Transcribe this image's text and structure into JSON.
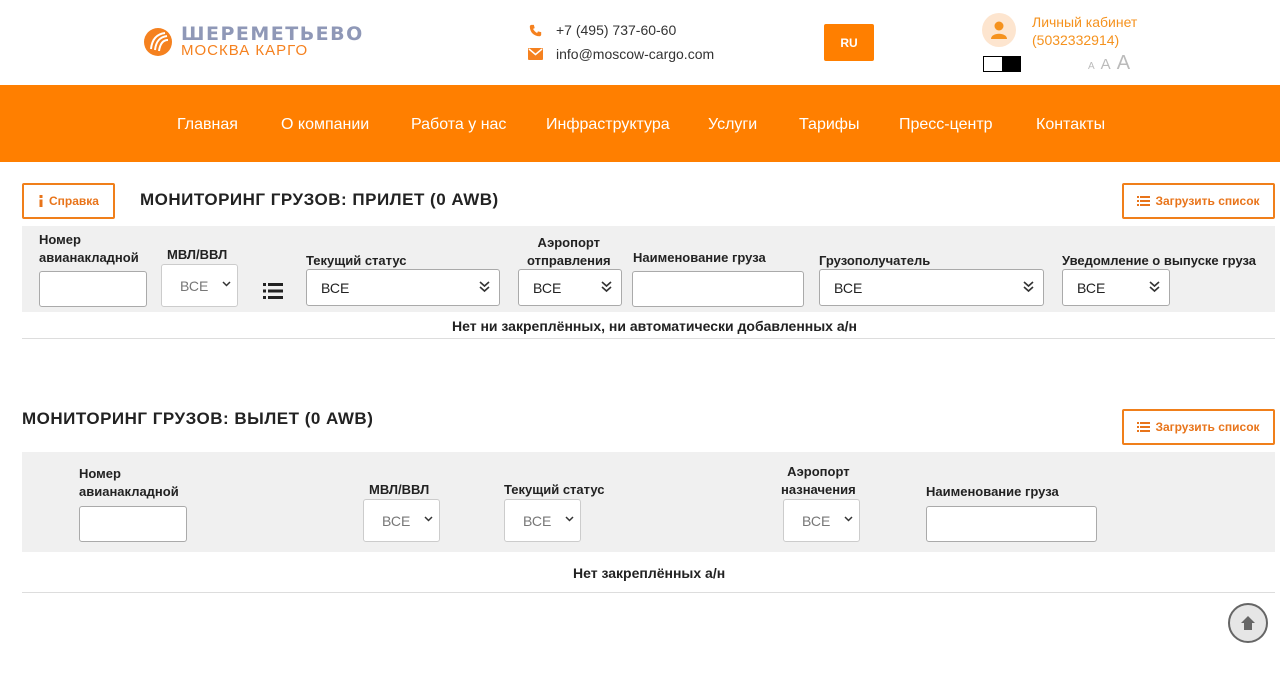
{
  "header": {
    "logo_title": "ШЕРЕМЕТЬЕВО",
    "logo_subtitle": "МОСКВА КАРГО",
    "phone": "+7 (495) 737-60-60",
    "email": "info@moscow-cargo.com",
    "lang": "RU",
    "cabinet_label": "Личный кабинет",
    "cabinet_id": "(5032332914)",
    "font_size_small": "A",
    "font_size_medium": "A",
    "font_size_large": "A"
  },
  "nav": {
    "items": [
      "Главная",
      "О компании",
      "Работа у нас",
      "Инфраструктура",
      "Услуги",
      "Тарифы",
      "Пресс-центр",
      "Контакты"
    ]
  },
  "arrival": {
    "help_label": "Справка",
    "title": "МОНИТОРИНГ ГРУЗОВ: ПРИЛЕТ  (0 AWB)",
    "load_label": "Загрузить список",
    "filters": {
      "awb_label_1": "Номер",
      "awb_label_2": "авианакладной",
      "mvl_label": "МВЛ/ВВЛ",
      "mvl_value": "ВСЕ",
      "status_label": "Текущий статус",
      "status_value": "ВСЕ",
      "airport_label_1": "Аэропорт",
      "airport_label_2": "отправления",
      "airport_value": "ВСЕ",
      "cargo_label": "Наименование груза",
      "consignee_label": "Грузополучатель",
      "consignee_value": "ВСЕ",
      "release_label": "Уведомление о выпуске груза",
      "release_value": "ВСЕ"
    },
    "empty_message": "Нет ни закреплённых, ни автоматически добавленных а/н"
  },
  "departure": {
    "title": "МОНИТОРИНГ ГРУЗОВ: ВЫЛЕТ  (0 AWB)",
    "load_label": "Загрузить список",
    "filters": {
      "awb_label_1": "Номер",
      "awb_label_2": "авианакладной",
      "mvl_label": "МВЛ/ВВЛ",
      "mvl_value": "ВСЕ",
      "status_label": "Текущий статус",
      "status_value": "ВСЕ",
      "airport_label_1": "Аэропорт",
      "airport_label_2": "назначения",
      "airport_value": "ВСЕ",
      "cargo_label": "Наименование груза"
    },
    "empty_message": "Нет закреплённых а/н"
  },
  "colors": {
    "brand_orange": "#ff7f00",
    "logo_gray": "#8f98b7",
    "filter_bg": "#f0f0f0"
  },
  "icons": [
    "phone-icon",
    "mail-icon",
    "user-icon",
    "info-icon",
    "list-icon",
    "arrow-up-icon",
    "chevron-down-icon"
  ]
}
